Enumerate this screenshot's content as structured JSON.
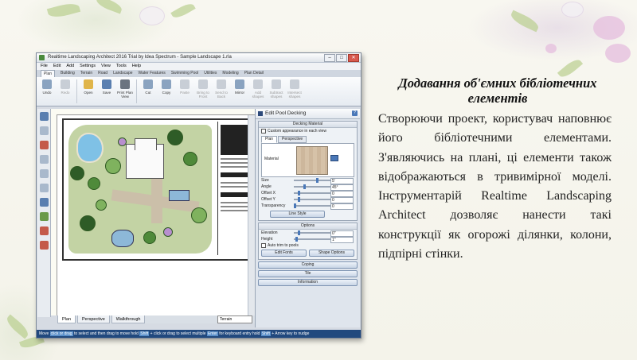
{
  "app": {
    "window_title": "Realtime Landscaping Architect 2016 Trial by Idea Spectrum - Sample Landscape 1.rla",
    "menu": [
      "File",
      "Edit",
      "Add",
      "Settings",
      "View",
      "Tools",
      "Help"
    ],
    "tabs": [
      "Plan",
      "Building",
      "Terrain",
      "Road",
      "Landscape",
      "Water Features",
      "Swimming Pool",
      "Utilities",
      "Modeling",
      "Plan Detail"
    ],
    "active_tab": "Plan",
    "ribbon": [
      "Undo",
      "Redo",
      "Open",
      "Save",
      "Print Plan View",
      "Cut",
      "Copy",
      "Paste",
      "Bring to Front",
      "Send to Back",
      "Mirror",
      "Add shapes",
      "Subtract shapes",
      "Intersect shapes"
    ],
    "view_tabs": [
      "Plan",
      "Perspective",
      "Walkthrough"
    ],
    "terrain_select": "Terrain",
    "status_parts": [
      "Move",
      "click or drag",
      "to select and then drag to move",
      "hold",
      "Shift",
      "+ click or drag",
      "to select multiple",
      "Enter",
      "for keyboard entry",
      "hold",
      "Shift",
      "+ Arrow key to nudge"
    ],
    "panel": {
      "title": "Edit Pool Decking",
      "help": "?",
      "decking_group": "Decking Material",
      "custom_appearance": "Custom appearance in each view",
      "inner_tabs": [
        "Plan",
        "Perspective"
      ],
      "material_label": "Material",
      "size_label": "Size",
      "size_value": "5'",
      "angle_label": "Angle",
      "angle_value": "45°",
      "offset_x_label": "Offset X",
      "offset_x_value": "0",
      "offset_y_label": "Offset Y",
      "offset_y_value": "0",
      "transparency_label": "Transparency",
      "transparency_value": "0",
      "line_style": "Line Style",
      "options_group": "Options",
      "elevation_label": "Elevation",
      "elevation_value": "0\"",
      "height_label": "Height",
      "height_value": "1\"",
      "auto_trim": "Auto trim to pools",
      "edit_fonts": "Edit Fonts",
      "shape_options": "Shape Options",
      "coping": "Coping",
      "tile": "Tile",
      "information": "Information"
    }
  },
  "slide": {
    "heading": "Додавання об'ємних бібліотечних елементів",
    "paragraph": "Створюючи проект, користувач наповнює його бібліотечними елементами. З'являючись на плані, ці елементи також відображаються в тривимірної моделі. Інструментарій Realtime Landscaping Architect дозволяє нанести такі конструкції як огорожі ділянки, колони, підпірні стінки."
  }
}
